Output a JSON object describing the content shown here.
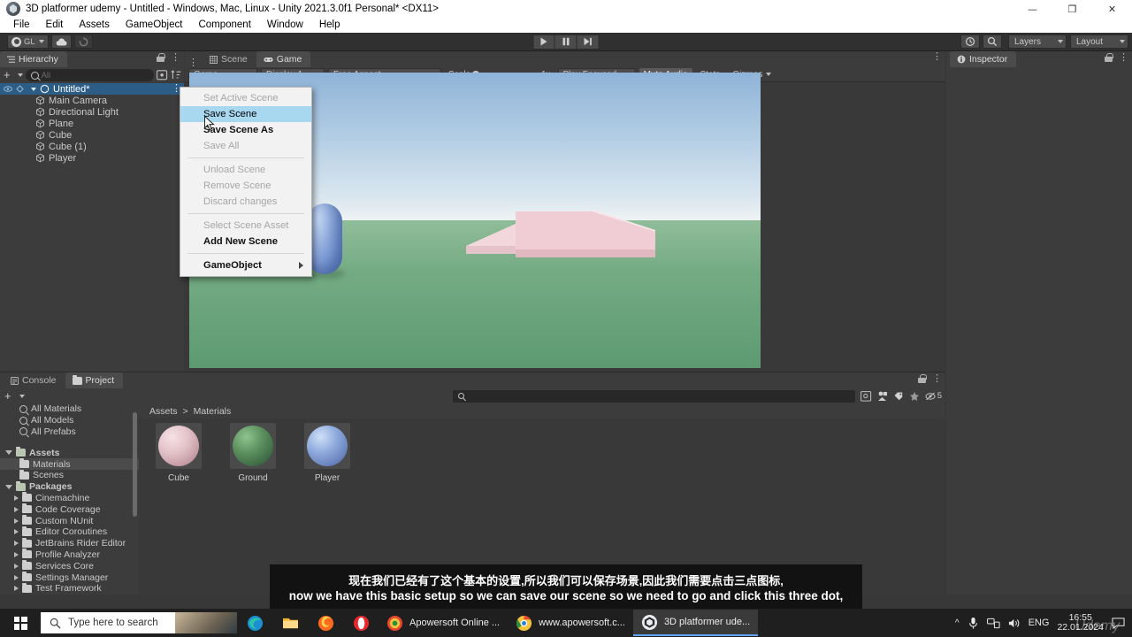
{
  "window": {
    "title": "3D platformer udemy - Untitled - Windows, Mac, Linux - Unity 2021.3.0f1 Personal* <DX11>",
    "minimize": "—",
    "maximize": "❐",
    "close": "✕"
  },
  "menubar": {
    "items": [
      "File",
      "Edit",
      "Assets",
      "GameObject",
      "Component",
      "Window",
      "Help"
    ]
  },
  "toolbar": {
    "account_label": "GL",
    "cloud_icon": "cloud-icon",
    "undo_history_icon": "history-icon",
    "search_icon": "search-icon",
    "layers_label": "Layers",
    "layout_label": "Layout",
    "play_icon": "play-icon",
    "pause_icon": "pause-icon",
    "step_icon": "step-icon"
  },
  "hierarchy": {
    "tab_label": "Hierarchy",
    "add_label": "+",
    "search_placeholder": "All",
    "items": [
      {
        "label": "Untitled*",
        "type": "scene",
        "selected": true,
        "depth": 0
      },
      {
        "label": "Main Camera",
        "type": "gameobject",
        "selected": false,
        "depth": 1
      },
      {
        "label": "Directional Light",
        "type": "gameobject",
        "selected": false,
        "depth": 1
      },
      {
        "label": "Plane",
        "type": "gameobject",
        "selected": false,
        "depth": 1
      },
      {
        "label": "Cube",
        "type": "gameobject",
        "selected": false,
        "depth": 1
      },
      {
        "label": "Cube (1)",
        "type": "gameobject",
        "selected": false,
        "depth": 1
      },
      {
        "label": "Player",
        "type": "gameobject",
        "selected": false,
        "depth": 1
      }
    ]
  },
  "center": {
    "tabs": [
      {
        "label": "Scene",
        "active": false,
        "icon": "scene-icon"
      },
      {
        "label": "Game",
        "active": true,
        "icon": "game-icon"
      }
    ],
    "game_toolbar": {
      "target_display_mode": "Game",
      "display": "Display 1",
      "aspect": "Free Aspect",
      "scale_label": "Scale",
      "scale_value": "1x",
      "play_mode": "Play Focused",
      "mute_audio": "Mute Audio",
      "stats": "Stats",
      "gizmos": "Gizmos"
    }
  },
  "inspector": {
    "tab_label": "Inspector"
  },
  "bottom_dock": {
    "tabs": [
      {
        "label": "Console",
        "active": false,
        "icon": "console-icon"
      },
      {
        "label": "Project",
        "active": true,
        "icon": "folder-icon"
      }
    ],
    "add_label": "+",
    "search_placeholder": "",
    "filter_icons": [
      "save-search-icon",
      "filter-type-icon",
      "filter-label-icon",
      "favorite-icon",
      "hidden-packages-icon"
    ],
    "hidden_packages_count": "5",
    "tree": [
      {
        "label": "All Materials",
        "kind": "search",
        "depth": 1,
        "selected": false,
        "expandable": false
      },
      {
        "label": "All Models",
        "kind": "search",
        "depth": 1,
        "selected": false,
        "expandable": false
      },
      {
        "label": "All Prefabs",
        "kind": "search",
        "depth": 1,
        "selected": false,
        "expandable": false
      },
      {
        "label": "Assets",
        "kind": "folder-root",
        "depth": 0,
        "selected": false,
        "expandable": true,
        "expanded": true
      },
      {
        "label": "Materials",
        "kind": "folder",
        "depth": 1,
        "selected": true,
        "expandable": false
      },
      {
        "label": "Scenes",
        "kind": "folder",
        "depth": 1,
        "selected": false,
        "expandable": false
      },
      {
        "label": "Packages",
        "kind": "folder-root",
        "depth": 0,
        "selected": false,
        "expandable": true,
        "expanded": true
      },
      {
        "label": "Cinemachine",
        "kind": "folder",
        "depth": 1,
        "selected": false,
        "expandable": true,
        "expanded": false
      },
      {
        "label": "Code Coverage",
        "kind": "folder",
        "depth": 1,
        "selected": false,
        "expandable": true,
        "expanded": false
      },
      {
        "label": "Custom NUnit",
        "kind": "folder",
        "depth": 1,
        "selected": false,
        "expandable": true,
        "expanded": false
      },
      {
        "label": "Editor Coroutines",
        "kind": "folder",
        "depth": 1,
        "selected": false,
        "expandable": true,
        "expanded": false
      },
      {
        "label": "JetBrains Rider Editor",
        "kind": "folder",
        "depth": 1,
        "selected": false,
        "expandable": true,
        "expanded": false
      },
      {
        "label": "Profile Analyzer",
        "kind": "folder",
        "depth": 1,
        "selected": false,
        "expandable": true,
        "expanded": false
      },
      {
        "label": "Services Core",
        "kind": "folder",
        "depth": 1,
        "selected": false,
        "expandable": true,
        "expanded": false
      },
      {
        "label": "Settings Manager",
        "kind": "folder",
        "depth": 1,
        "selected": false,
        "expandable": true,
        "expanded": false
      },
      {
        "label": "Test Framework",
        "kind": "folder",
        "depth": 1,
        "selected": false,
        "expandable": true,
        "expanded": false
      }
    ],
    "breadcrumb": [
      "Assets",
      "Materials"
    ],
    "breadcrumb_separator": ">",
    "assets": [
      {
        "name": "Cube",
        "color": "#d9b4bb"
      },
      {
        "name": "Ground",
        "color": "#4b7a4e"
      },
      {
        "name": "Player",
        "color": "#7d9ed4"
      }
    ]
  },
  "context_menu": {
    "items": [
      {
        "label": "Set Active Scene",
        "state": "disabled",
        "submenu": false
      },
      {
        "label": "Save Scene",
        "state": "highlighted",
        "submenu": false
      },
      {
        "label": "Save Scene As",
        "state": "bold",
        "submenu": false
      },
      {
        "label": "Save All",
        "state": "disabled",
        "submenu": false
      },
      {
        "label": "",
        "state": "separator",
        "submenu": false
      },
      {
        "label": "Unload Scene",
        "state": "disabled",
        "submenu": false
      },
      {
        "label": "Remove Scene",
        "state": "disabled",
        "submenu": false
      },
      {
        "label": "Discard changes",
        "state": "disabled",
        "submenu": false
      },
      {
        "label": "",
        "state": "separator",
        "submenu": false
      },
      {
        "label": "Select Scene Asset",
        "state": "disabled",
        "submenu": false
      },
      {
        "label": "Add New Scene",
        "state": "bold",
        "submenu": false
      },
      {
        "label": "",
        "state": "separator",
        "submenu": false
      },
      {
        "label": "GameObject",
        "state": "bold",
        "submenu": true
      }
    ]
  },
  "subtitles": {
    "chinese": "现在我们已经有了这个基本的设置,所以我们可以保存场景,因此我们需要点击三点图标,",
    "english": "now we have this basic setup so we can save our scene so we need to go and click this three dot,"
  },
  "taskbar": {
    "search_placeholder": "Type here to search",
    "apps": [
      "edge-icon",
      "file-explorer-icon",
      "firefox-icon",
      "opera-icon"
    ],
    "tasks": [
      {
        "label": "Apowersoft Online ...",
        "icon": "apowersoft-icon",
        "active": false
      },
      {
        "label": "www.apowersoft.c...",
        "icon": "chrome-icon",
        "active": false
      },
      {
        "label": "3D platformer ude...",
        "icon": "unity-icon",
        "active": true
      }
    ],
    "tray": {
      "chevron": "^",
      "icons": [
        "mic-icon",
        "network-icon",
        "volume-icon"
      ],
      "language": "ENG",
      "time": "16:55",
      "date": "22.01.2024"
    },
    "watermark": "Udemy"
  }
}
